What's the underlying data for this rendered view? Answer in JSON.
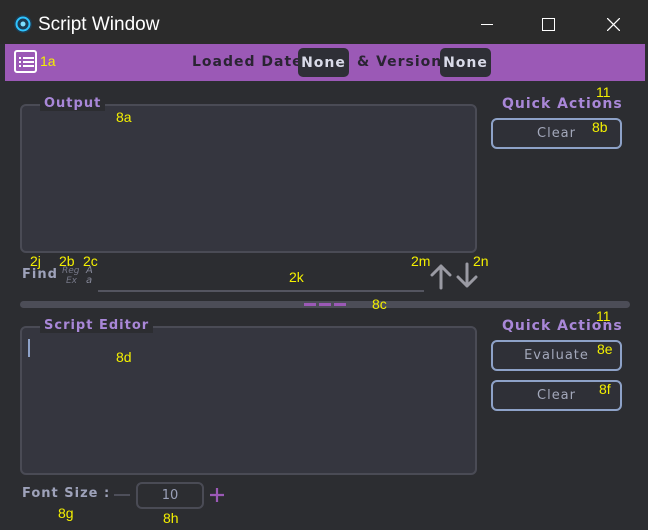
{
  "window": {
    "title": "Script Window",
    "controls": [
      "minimize-icon",
      "maximize-icon",
      "close-icon"
    ]
  },
  "toolbar": {
    "menu_icon": "list-menu-icon",
    "loaded_date_label": "Loaded Date",
    "loaded_date_value": "None",
    "version_label": "& Version",
    "version_value": "None"
  },
  "output": {
    "title": "Output",
    "content": ""
  },
  "quick_actions_top": {
    "label": "Quick Actions",
    "clear_label": "Clear"
  },
  "find": {
    "label": "Find",
    "regex_top": "Reg",
    "regex_bottom": "Ex",
    "case_top": "A",
    "case_bottom": "a",
    "value": "",
    "up_icon": "arrow-up-icon",
    "down_icon": "arrow-down-icon"
  },
  "editor": {
    "title": "Script Editor",
    "content": ""
  },
  "quick_actions_bottom": {
    "label": "Quick Actions",
    "evaluate_label": "Evaluate",
    "clear_label": "Clear"
  },
  "font_size": {
    "label": "Font Size :",
    "value": "10"
  },
  "annotations": {
    "a1a": "1a",
    "a11_top": "11",
    "a8a": "8a",
    "a8b": "8b",
    "a2j": "2j",
    "a2b": "2b",
    "a2c": "2c",
    "a2k": "2k",
    "a2m": "2m",
    "a2n": "2n",
    "a8c": "8c",
    "a11_bottom": "11",
    "a8d": "8d",
    "a8e": "8e",
    "a8f": "8f",
    "a8g": "8g",
    "a8h": "8h"
  },
  "colors": {
    "accent": "#9b59b6",
    "background": "#2c2d31",
    "panel": "#35363f",
    "button_border": "#8ea2c8",
    "annotation": "#f4f000"
  }
}
